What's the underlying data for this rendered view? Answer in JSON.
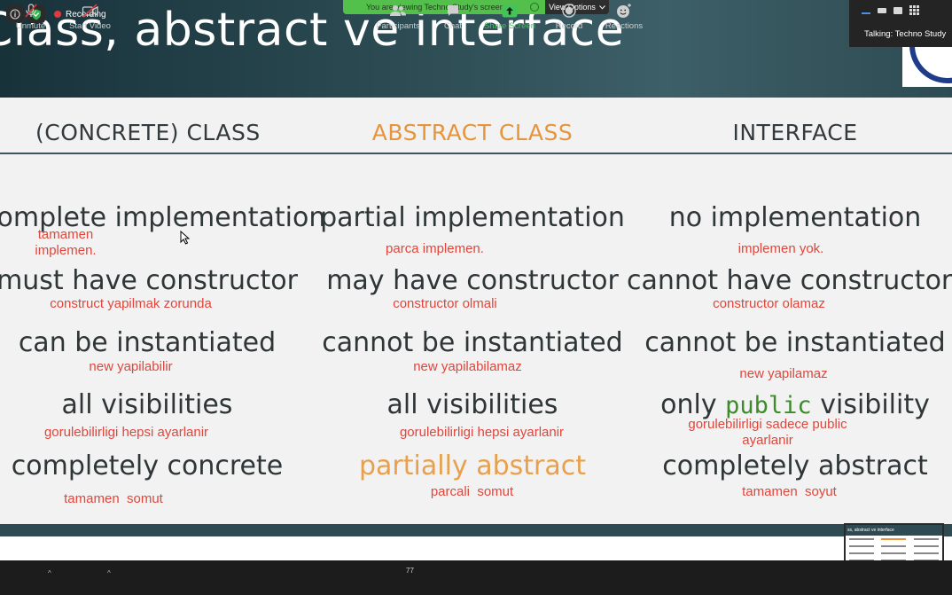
{
  "slide": {
    "title": "Class, abstract ve interface",
    "columns": [
      {
        "heading": "(CONCRETE) CLASS",
        "rows": [
          {
            "term": "complete implementation",
            "note": "tamamen\nimplemen."
          },
          {
            "term": "must have constructor",
            "note": "construct yapilmak zorunda"
          },
          {
            "term": "can be instantiated",
            "note": "new yapilabilir"
          },
          {
            "term": "all visibilities",
            "note": "gorulebilirligi hepsi ayarlanir"
          },
          {
            "term": "completely concrete",
            "note": "tamamen  somut"
          }
        ]
      },
      {
        "heading": "ABSTRACT CLASS",
        "rows": [
          {
            "term": "partial implementation",
            "note": "parca implemen."
          },
          {
            "term": "may have constructor",
            "note": "constructor olmali"
          },
          {
            "term": "cannot be instantiated",
            "note": "new yapilabilamaz"
          },
          {
            "term": "all visibilities",
            "note": "gorulebilirligi hepsi ayarlanir"
          },
          {
            "term": "partially abstract",
            "note": "parcali  somut"
          }
        ]
      },
      {
        "heading": "INTERFACE",
        "rows": [
          {
            "term": "no implementation",
            "note": "implemen yok."
          },
          {
            "term": "cannot have constructors",
            "note": "constructor olamaz"
          },
          {
            "term": "cannot be instantiated",
            "note": "new yapilamaz"
          },
          {
            "term_prefix": "only ",
            "term_code": "public",
            "term_suffix": " visibility",
            "note": "gorulebilirligi sadece public\nayarlanir"
          },
          {
            "term": "completely abstract",
            "note": "tamamen  soyut"
          }
        ]
      }
    ],
    "thumbnail_title": "ss, abstract ve interface"
  },
  "zoom": {
    "recording_label": "Recording",
    "viewing_banner": "You are viewing Techno Study's screen",
    "view_options": "View Options",
    "talking": "Talking: Techno Study",
    "participant_count": "77",
    "toolbar": {
      "unmute": "Unmute",
      "start_video": "Start Video",
      "participants": "Participants",
      "chat": "Chat",
      "share_screen": "Share Screen",
      "record": "Record",
      "reactions": "Reactions"
    }
  },
  "colors": {
    "slide_header_bg": "#2b4a52",
    "orange_accent": "#e6953d",
    "note_red": "#e0463c",
    "zoom_green": "#43c35a"
  }
}
